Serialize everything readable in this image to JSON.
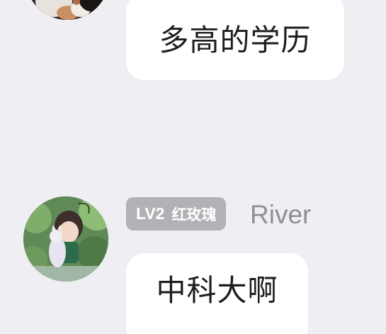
{
  "messages": [
    {
      "avatar_icon": "user-avatar-dark-photo-icon",
      "text": "多高的学历"
    },
    {
      "avatar_icon": "user-avatar-anime-character-icon",
      "level": "LV2",
      "level_title": "红玫瑰",
      "username": "River",
      "text": "中科大啊"
    }
  ],
  "colors": {
    "background": "#efeff3",
    "bubble": "#ffffff",
    "badge": "#b2b2b6",
    "username": "#8e8e93",
    "text": "#1d1d1f"
  }
}
